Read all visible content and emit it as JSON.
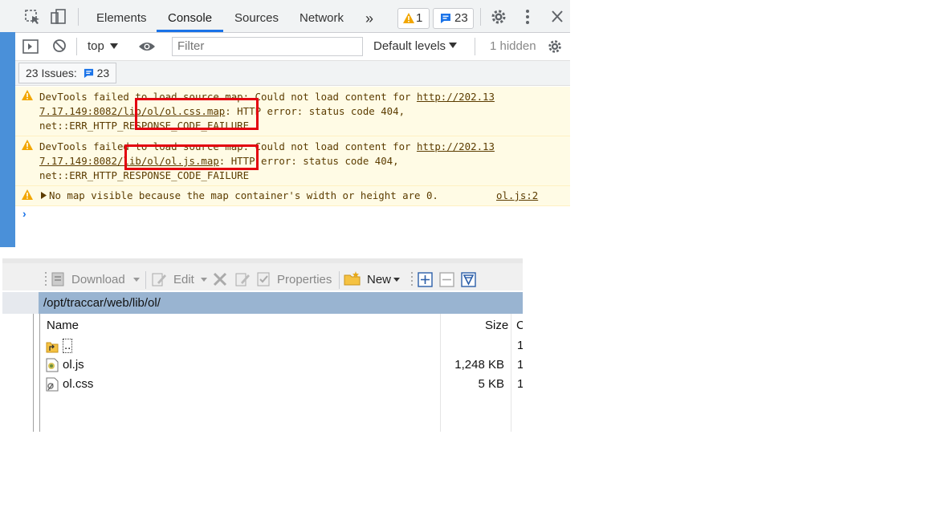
{
  "devtools": {
    "tabs": [
      "Elements",
      "Console",
      "Sources",
      "Network"
    ],
    "more_tabs": "»",
    "warnings_count": "1",
    "messages_count": "23",
    "context": "top",
    "filter_placeholder": "Filter",
    "levels": "Default levels",
    "hidden": "1 hidden",
    "issues_label": "23 Issues:",
    "issues_count": "23",
    "messages": [
      {
        "line1": "DevTools failed to load source map: Could not load content for ",
        "url_part1": "http://202.13",
        "url_part2": "7.17.149:8082/lib/ol/ol.css.map",
        "line2_rest": ": HTTP error: status code 404,",
        "line3": "net::ERR_HTTP_RESPONSE_CODE_FAILURE"
      },
      {
        "line1": "DevTools failed to load source map: Could not load content for ",
        "url_part1": "http://202.13",
        "url_part2": "7.17.149:8082/lib/ol/ol.js.map",
        "line2_rest": ": HTTP error: status code 404,",
        "line3": "net::ERR_HTTP_RESPONSE_CODE_FAILURE"
      },
      {
        "text": "No map visible because the map container's width or height are 0.",
        "source": "ol.js:2"
      }
    ],
    "prompt": "›"
  },
  "filepanel": {
    "toolbar": {
      "download": "Download",
      "edit": "Edit",
      "properties": "Properties",
      "new": "New"
    },
    "path": "/opt/traccar/web/lib/ol/",
    "columns": {
      "name": "Name",
      "size": "Size",
      "changed": "C"
    },
    "rows": [
      {
        "name": "..",
        "size": "",
        "changed": "1,"
      },
      {
        "name": "ol.js",
        "size": "1,248 KB",
        "changed": "1,"
      },
      {
        "name": "ol.css",
        "size": "5 KB",
        "changed": "1,"
      }
    ]
  },
  "colors": {
    "warning_bg": "#fffbe5",
    "highlight_box": "#e3000f",
    "accent": "#1a73e8",
    "path_bar": "#99b4d1"
  }
}
